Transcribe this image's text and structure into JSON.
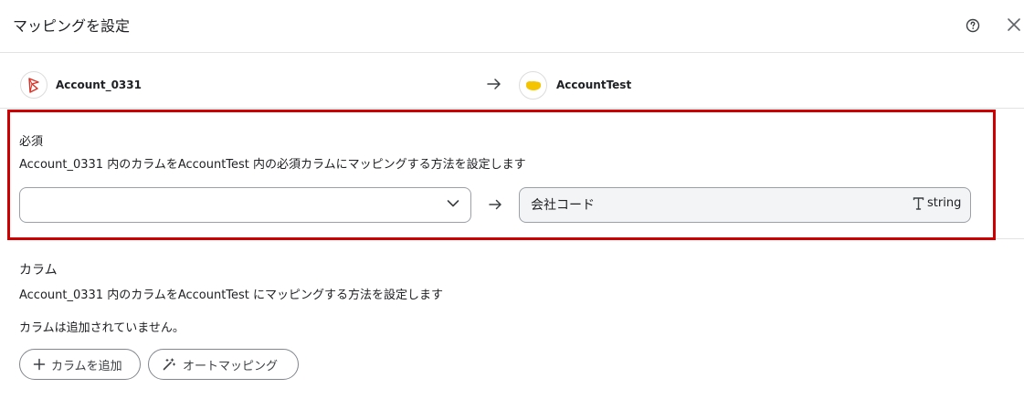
{
  "dialog": {
    "title": "マッピングを設定"
  },
  "mapping": {
    "source_name": "Account_0331",
    "destination_name": "AccountTest"
  },
  "required": {
    "label": "必須",
    "description": "Account_0331 内のカラムをAccountTest 内の必須カラムにマッピングする方法を設定します",
    "source_selected": "",
    "target_column": "会社コード",
    "target_type": "string"
  },
  "columns": {
    "label": "カラム",
    "description": "Account_0331 内のカラムをAccountTest にマッピングする方法を設定します",
    "empty_message": "カラムは追加されていません。",
    "add_button": "カラムを追加",
    "auto_button": "オートマッピング"
  },
  "colors": {
    "highlight": "#cc0000",
    "source_logo": "#d93025",
    "destination_logo": "#f4c400"
  }
}
